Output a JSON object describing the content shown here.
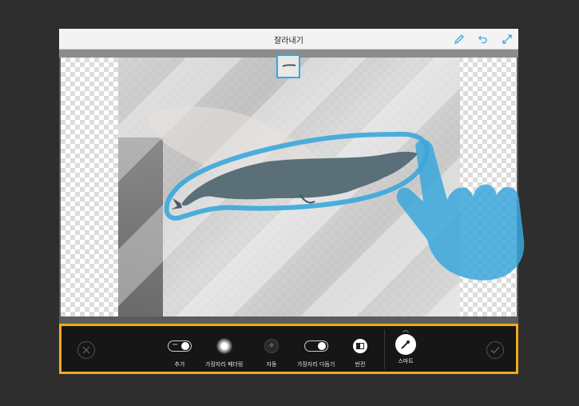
{
  "window": {
    "title": "잘라내기"
  },
  "titlebar_icons": [
    "pencil-icon",
    "undo-icon",
    "expand-icon"
  ],
  "colors": {
    "accent_blue": "#3aa7dc",
    "toolbar_border": "#f2a91e",
    "toolbar_bg": "#161616"
  },
  "toolbar": {
    "cancel_icon": "close-icon",
    "confirm_icon": "check-icon",
    "add_label": "추가",
    "feather_label": "가장자리 페더링",
    "auto_label": "자동",
    "refine_label": "가장자리 다듬기",
    "invert_label": "반전",
    "smart_label": "스마트"
  }
}
